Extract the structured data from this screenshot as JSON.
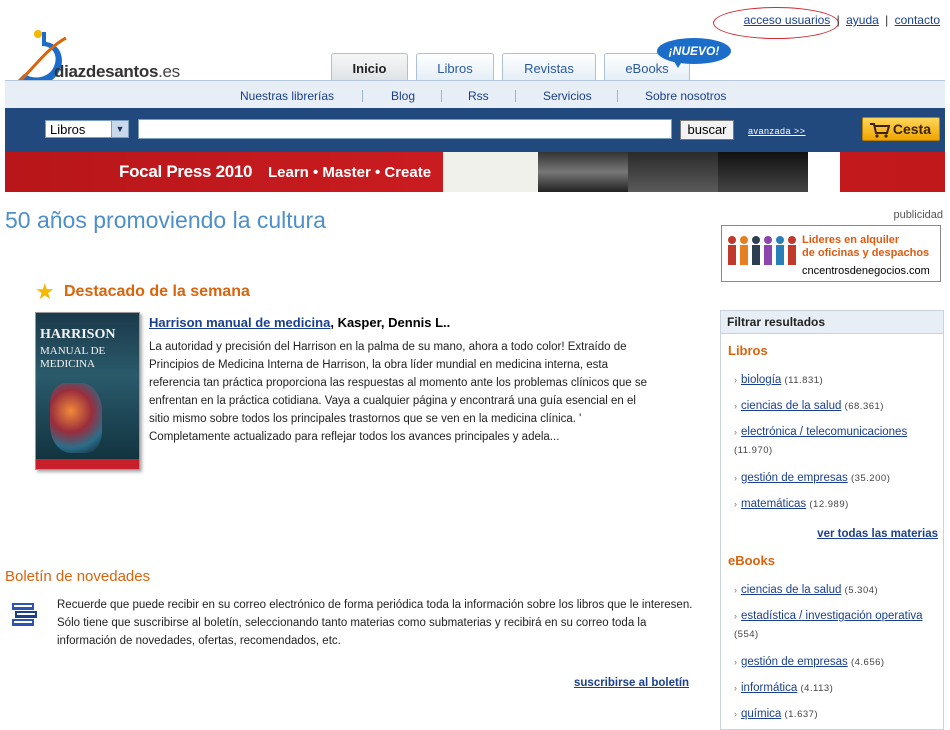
{
  "top_links": {
    "acceso": "acceso usuarios",
    "ayuda": "ayuda",
    "contacto": "contacto",
    "sep": "|"
  },
  "logo": {
    "name": "diazdesantos",
    "tld": ".es"
  },
  "tabs": [
    {
      "label": "Inicio"
    },
    {
      "label": "Libros"
    },
    {
      "label": "Revistas"
    },
    {
      "label": "eBooks"
    }
  ],
  "nuevo_badge": "¡NUEVO!",
  "subnav": [
    "Nuestras librerías",
    "Blog",
    "Rss",
    "Servicios",
    "Sobre nosotros"
  ],
  "search": {
    "category": "Libros",
    "value": "",
    "button": "buscar",
    "advanced": "avanzada >>"
  },
  "cart": {
    "label": "Cesta"
  },
  "banner": {
    "brand": "Focal Press 2010",
    "slogan": "Learn • Master • Create"
  },
  "headline": "50 años promoviendo la cultura",
  "publicidad": "publicidad",
  "ad": {
    "line1": "Lideres en alquiler",
    "line2": "de oficinas y despachos",
    "domain": "cncentrosdenegocios.com"
  },
  "featured": {
    "section_title": "Destacado de la semana",
    "book_cover_title": "HARRISON",
    "book_cover_subtitle1": "MANUAL DE",
    "book_cover_subtitle2": "MEDICINA",
    "title": "Harrison manual de medicina",
    "author": ", Kasper, Dennis L..",
    "description": "La autoridad y precisión del Harrison en la palma de su mano, ahora a todo color! Extraído de Principios de Medicina Interna de Harrison, la obra líder mundial en medicina interna, esta referencia tan práctica proporciona las respuestas al momento ante los problemas clínicos que se enfrentan en la práctica cotidiana. Vaya a cualquier página y encontrará una guía esencial en el sitio mismo sobre todos los principales trastornos que se ven en la medicina clínica. ' Completamente actualizado para reflejar todos los avances principales y adela..."
  },
  "boletin": {
    "title": "Boletín de novedades",
    "text": "Recuerde que puede recibir en su correo electrónico de forma periódica toda la información sobre los libros que le interesen. Sólo tiene que suscribirse al boletín, seleccionando tanto materias como submaterias y recibirá en su correo toda la información de novedades, ofertas, recomendados, etc.",
    "link": "suscribirse al boletín"
  },
  "filter": {
    "header": "Filtrar resultados",
    "libros_title": "Libros",
    "libros": [
      {
        "name": "biología",
        "count": "(11.831)"
      },
      {
        "name": "ciencias de la salud",
        "count": "(68.361)"
      },
      {
        "name": "electrónica / telecomunicaciones",
        "count": "(11.970)"
      },
      {
        "name": "gestión de empresas",
        "count": "(35.200)"
      },
      {
        "name": "matemáticas",
        "count": "(12.989)"
      }
    ],
    "ver_todas": "ver todas las materias",
    "ebooks_title": "eBooks",
    "ebooks": [
      {
        "name": "ciencias de la salud",
        "count": "(5.304)"
      },
      {
        "name": "estadística / investigación operativa",
        "count": "(554)"
      },
      {
        "name": "gestión de empresas",
        "count": "(4.656)"
      },
      {
        "name": "informática",
        "count": "(4.113)"
      },
      {
        "name": "química",
        "count": "(1.637)"
      }
    ]
  },
  "colors": {
    "accent_blue": "#21497d",
    "orange": "#d9640c",
    "headline": "#4f8fc9",
    "banner_red": "#cc1d21"
  }
}
